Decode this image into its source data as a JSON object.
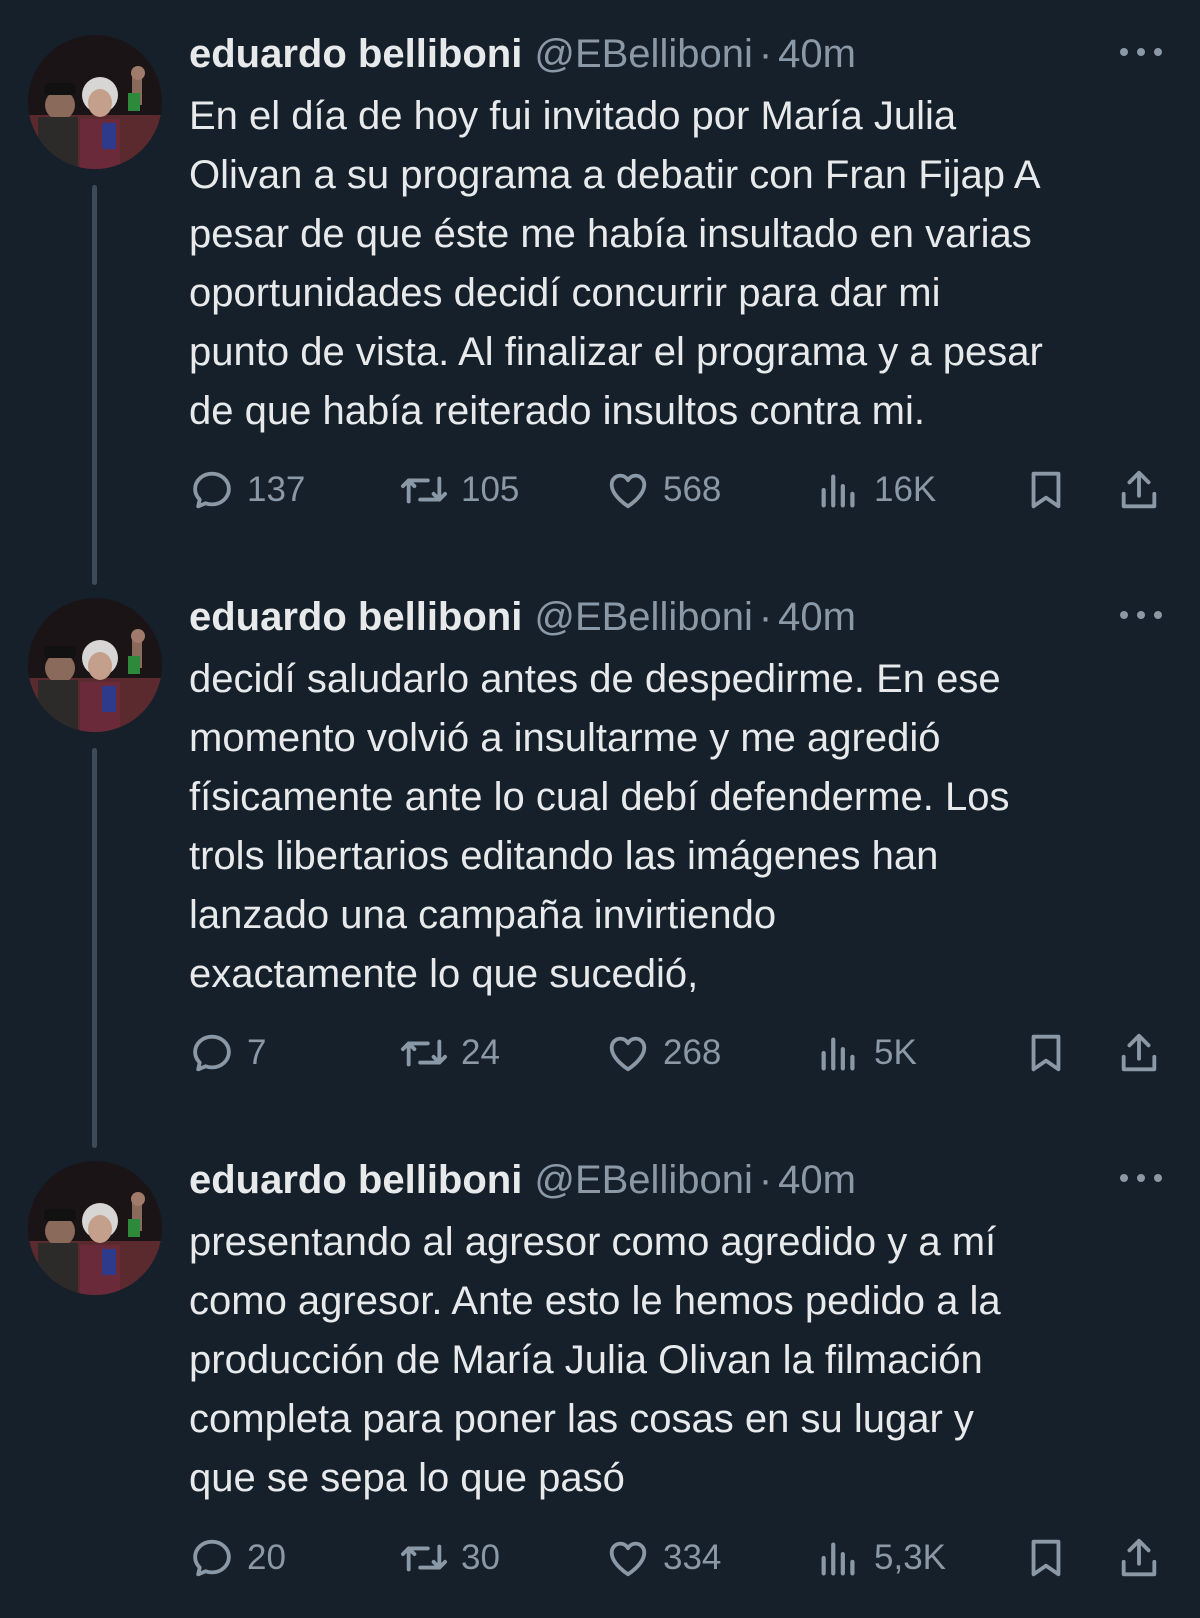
{
  "tweets": [
    {
      "name": "eduardo belliboni",
      "handle": "@EBelliboni",
      "separator": "·",
      "time": "40m",
      "lines": [
        "En el día de hoy fui invitado por María Julia",
        "Olivan a su programa a debatir con Fran Fijap A",
        "pesar de que éste me había insultado en varias",
        "oportunidades decidí concurrir para dar mi",
        "punto de vista. Al finalizar el programa y a pesar",
        "de que había reiterado insultos contra mi."
      ],
      "replies": "137",
      "retweets": "105",
      "likes": "568",
      "views": "16K"
    },
    {
      "name": "eduardo belliboni",
      "handle": "@EBelliboni",
      "separator": "·",
      "time": "40m",
      "lines": [
        "decidí saludarlo antes de despedirme. En ese",
        "momento volvió a insultarme y me agredió",
        "físicamente ante lo cual debí defenderme. Los",
        "trols libertarios editando las imágenes han",
        "lanzado una campaña invirtiendo",
        "exactamente lo que sucedió,"
      ],
      "replies": "7",
      "retweets": "24",
      "likes": "268",
      "views": "5K"
    },
    {
      "name": "eduardo belliboni",
      "handle": "@EBelliboni",
      "separator": "·",
      "time": "40m",
      "lines": [
        "presentando al agresor como agredido y a mí",
        "como agresor. Ante esto le hemos pedido a la",
        "producción de María Julia Olivan la filmación",
        "completa para poner las cosas en su lugar y",
        "que se sepa lo que pasó"
      ],
      "replies": "20",
      "retweets": "30",
      "likes": "334",
      "views": "5,3K"
    }
  ],
  "icons": {
    "reply": "reply-icon",
    "retweet": "retweet-icon",
    "like": "heart-icon",
    "views": "views-icon",
    "bookmark": "bookmark-icon",
    "share": "share-icon",
    "more": "more-icon"
  },
  "colors": {
    "background": "#15202b",
    "text": "#e7e9ea",
    "secondary": "#8b98a5",
    "thread_line": "#3d4a57"
  }
}
